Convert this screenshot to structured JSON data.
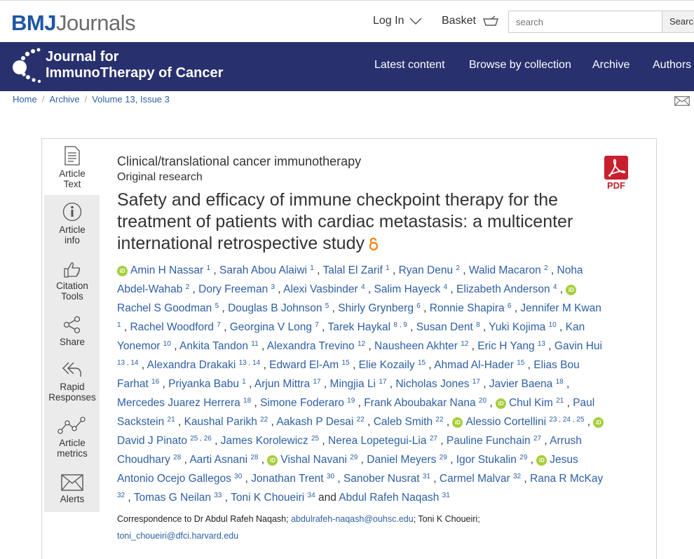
{
  "header": {
    "logo_brand": "BMJ",
    "logo_word": "Journals",
    "login_label": "Log In",
    "basket_label": "Basket",
    "search_placeholder": "search",
    "search_button": "Search"
  },
  "journal": {
    "title_line1": "Journal for",
    "title_line2": "ImmunoTherapy of Cancer",
    "nav": [
      "Latest content",
      "Browse by collection",
      "Archive",
      "Authors"
    ]
  },
  "breadcrumb": [
    "Home",
    "Archive",
    "Volume 13, Issue 3"
  ],
  "sidebar": {
    "tabs": [
      {
        "line1": "Article",
        "line2": "Text",
        "icon": "document-icon"
      },
      {
        "line1": "Article",
        "line2": "info",
        "icon": "info-icon"
      },
      {
        "line1": "Citation",
        "line2": "Tools",
        "icon": "thumbs-up-icon"
      },
      {
        "line1": "Share",
        "line2": "",
        "icon": "share-icon"
      },
      {
        "line1": "Rapid",
        "line2": "Responses",
        "icon": "reply-all-icon"
      },
      {
        "line1": "Article",
        "line2": "metrics",
        "icon": "metrics-icon"
      },
      {
        "line1": "Alerts",
        "line2": "",
        "icon": "envelope-icon"
      }
    ]
  },
  "article": {
    "category": "Clinical/translational cancer immunotherapy",
    "type": "Original research",
    "title": "Safety and efficacy of immune checkpoint therapy for the treatment of patients with cardiac metastasis: a multicenter international retrospective study",
    "pdf_label": "PDF",
    "authors": [
      {
        "name": "Amin H Nassar",
        "aff": "1",
        "orcid": true
      },
      {
        "name": "Sarah Abou Alaiwi",
        "aff": "1",
        "orcid": false
      },
      {
        "name": "Talal El Zarif",
        "aff": "1",
        "orcid": false
      },
      {
        "name": "Ryan Denu",
        "aff": "2",
        "orcid": false
      },
      {
        "name": "Walid Macaron",
        "aff": "2",
        "orcid": false
      },
      {
        "name": "Noha Abdel-Wahab",
        "aff": "2",
        "orcid": false
      },
      {
        "name": "Dory Freeman",
        "aff": "3",
        "orcid": false
      },
      {
        "name": "Alexi Vasbinder",
        "aff": "4",
        "orcid": false
      },
      {
        "name": "Salim Hayeck",
        "aff": "4",
        "orcid": false
      },
      {
        "name": "Elizabeth Anderson",
        "aff": "4",
        "orcid": false
      },
      {
        "name": "Rachel S Goodman",
        "aff": "5",
        "orcid": true
      },
      {
        "name": "Douglas B Johnson",
        "aff": "5",
        "orcid": false
      },
      {
        "name": "Shirly Grynberg",
        "aff": "6",
        "orcid": false
      },
      {
        "name": "Ronnie Shapira",
        "aff": "6",
        "orcid": false
      },
      {
        "name": "Jennifer M Kwan",
        "aff": "1",
        "orcid": false
      },
      {
        "name": "Rachel Woodford",
        "aff": "7",
        "orcid": false
      },
      {
        "name": "Georgina V Long",
        "aff": "7",
        "orcid": false
      },
      {
        "name": "Tarek Haykal",
        "aff": "8 ,  9",
        "orcid": false
      },
      {
        "name": "Susan Dent",
        "aff": "8",
        "orcid": false
      },
      {
        "name": "Yuki Kojima",
        "aff": "10",
        "orcid": false
      },
      {
        "name": "Kan Yonemor",
        "aff": "10",
        "orcid": false
      },
      {
        "name": "Ankita Tandon",
        "aff": "11",
        "orcid": false
      },
      {
        "name": "Alexandra Trevino",
        "aff": "12",
        "orcid": false
      },
      {
        "name": "Nausheen Akhter",
        "aff": "12",
        "orcid": false
      },
      {
        "name": "Eric H Yang",
        "aff": "13",
        "orcid": false
      },
      {
        "name": "Gavin Hui",
        "aff": "13 ,  14",
        "orcid": false
      },
      {
        "name": "Alexandra Drakaki",
        "aff": "13 ,  14",
        "orcid": false
      },
      {
        "name": "Edward El-Am",
        "aff": "15",
        "orcid": false
      },
      {
        "name": "Elie Kozaily",
        "aff": "15",
        "orcid": false
      },
      {
        "name": "Ahmad Al-Hader",
        "aff": "15",
        "orcid": false
      },
      {
        "name": "Elias Bou Farhat",
        "aff": "16",
        "orcid": false
      },
      {
        "name": "Priyanka Babu",
        "aff": "1",
        "orcid": false
      },
      {
        "name": "Arjun Mittra",
        "aff": "17",
        "orcid": false
      },
      {
        "name": "Mingjia Li",
        "aff": "17",
        "orcid": false
      },
      {
        "name": "Nicholas Jones",
        "aff": "17",
        "orcid": false
      },
      {
        "name": "Javier Baena",
        "aff": "18",
        "orcid": false
      },
      {
        "name": "Mercedes Juarez Herrera",
        "aff": "18",
        "orcid": false
      },
      {
        "name": "Simone Foderaro",
        "aff": "19",
        "orcid": false
      },
      {
        "name": "Frank Aboubakar Nana",
        "aff": "20",
        "orcid": false
      },
      {
        "name": "Chul Kim",
        "aff": "21",
        "orcid": true
      },
      {
        "name": "Paul Sackstein",
        "aff": "21",
        "orcid": false
      },
      {
        "name": "Kaushal Parikh",
        "aff": "22",
        "orcid": false
      },
      {
        "name": "Aakash P Desai",
        "aff": "22",
        "orcid": false
      },
      {
        "name": "Caleb Smith",
        "aff": "22",
        "orcid": false
      },
      {
        "name": "Alessio Cortellini",
        "aff": "23 ,  24 ,  25",
        "orcid": true
      },
      {
        "name": "David J Pinato",
        "aff": "25 ,  26",
        "orcid": true
      },
      {
        "name": "James Korolewicz",
        "aff": "25",
        "orcid": false
      },
      {
        "name": "Nerea Lopetegui-Lia",
        "aff": "27",
        "orcid": false
      },
      {
        "name": "Pauline Funchain",
        "aff": "27",
        "orcid": false
      },
      {
        "name": "Arrush Choudhary",
        "aff": "28",
        "orcid": false
      },
      {
        "name": "Aarti Asnani",
        "aff": "28",
        "orcid": false
      },
      {
        "name": "Vishal Navani",
        "aff": "29",
        "orcid": true
      },
      {
        "name": "Daniel Meyers",
        "aff": "29",
        "orcid": false
      },
      {
        "name": "Igor Stukalin",
        "aff": "29",
        "orcid": false
      },
      {
        "name": "Jesus Antonio Ocejo Gallegos",
        "aff": "30",
        "orcid": true
      },
      {
        "name": "Jonathan Trent",
        "aff": "30",
        "orcid": false
      },
      {
        "name": "Sanober Nusrat",
        "aff": "31",
        "orcid": false
      },
      {
        "name": "Carmel Malvar",
        "aff": "32",
        "orcid": false
      },
      {
        "name": "Rana R McKay",
        "aff": "32",
        "orcid": false
      },
      {
        "name": "Tomas G Neilan",
        "aff": "33",
        "orcid": false
      },
      {
        "name": "Toni K Choueiri",
        "aff": "34",
        "orcid": false
      },
      {
        "name": "Abdul Rafeh Naqash",
        "aff": "31",
        "orcid": false
      }
    ],
    "and_word": "and",
    "orcid_glyph": "iD",
    "correspondence": {
      "prefix": "Correspondence to Dr Abdul Rafeh Naqash;",
      "email1": "abdulrafeh-naqash@ouhsc.edu",
      "middle": "; Toni K Choueiri;",
      "email2": "toni_choueiri@dfci.harvard.edu"
    }
  },
  "colors": {
    "brand_blue": "#2a5ea8",
    "journal_band": "#28306e",
    "link": "#2e5fa3",
    "orcid_green": "#a6ce39",
    "pdf_red": "#c8202f",
    "open_access_orange": "#f68212"
  }
}
